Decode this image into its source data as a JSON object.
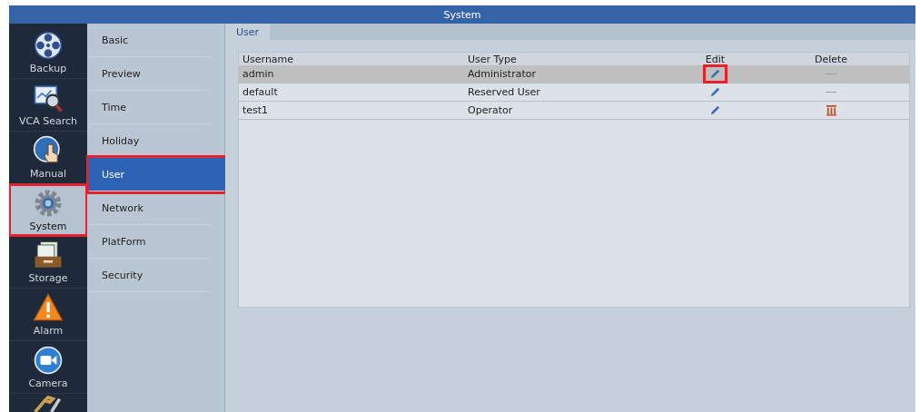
{
  "window": {
    "title": "System"
  },
  "nav": [
    {
      "label": "Backup",
      "selected": false,
      "highlighted": false
    },
    {
      "label": "VCA Search",
      "selected": false,
      "highlighted": false
    },
    {
      "label": "Manual",
      "selected": false,
      "highlighted": false
    },
    {
      "label": "System",
      "selected": true,
      "highlighted": true
    },
    {
      "label": "Storage",
      "selected": false,
      "highlighted": false
    },
    {
      "label": "Alarm",
      "selected": false,
      "highlighted": false
    },
    {
      "label": "Camera",
      "selected": false,
      "highlighted": false
    }
  ],
  "submenu": [
    {
      "label": "Basic",
      "selected": false,
      "highlighted": false
    },
    {
      "label": "Preview",
      "selected": false,
      "highlighted": false
    },
    {
      "label": "Time",
      "selected": false,
      "highlighted": false
    },
    {
      "label": "Holiday",
      "selected": false,
      "highlighted": false
    },
    {
      "label": "User",
      "selected": true,
      "highlighted": true
    },
    {
      "label": "Network",
      "selected": false,
      "highlighted": false
    },
    {
      "label": "PlatForm",
      "selected": false,
      "highlighted": false
    },
    {
      "label": "Security",
      "selected": false,
      "highlighted": false
    }
  ],
  "tabs": [
    {
      "label": "User",
      "selected": true
    }
  ],
  "table": {
    "columns": [
      "Username",
      "User Type",
      "Edit",
      "Delete"
    ],
    "rows": [
      {
        "username": "admin",
        "user_type": "Administrator",
        "selected": true,
        "edit_highlighted": true,
        "deletable": false
      },
      {
        "username": "default",
        "user_type": "Reserved User",
        "selected": false,
        "edit_highlighted": false,
        "deletable": false
      },
      {
        "username": "test1",
        "user_type": "Operator",
        "selected": false,
        "edit_highlighted": false,
        "deletable": true
      }
    ]
  }
}
